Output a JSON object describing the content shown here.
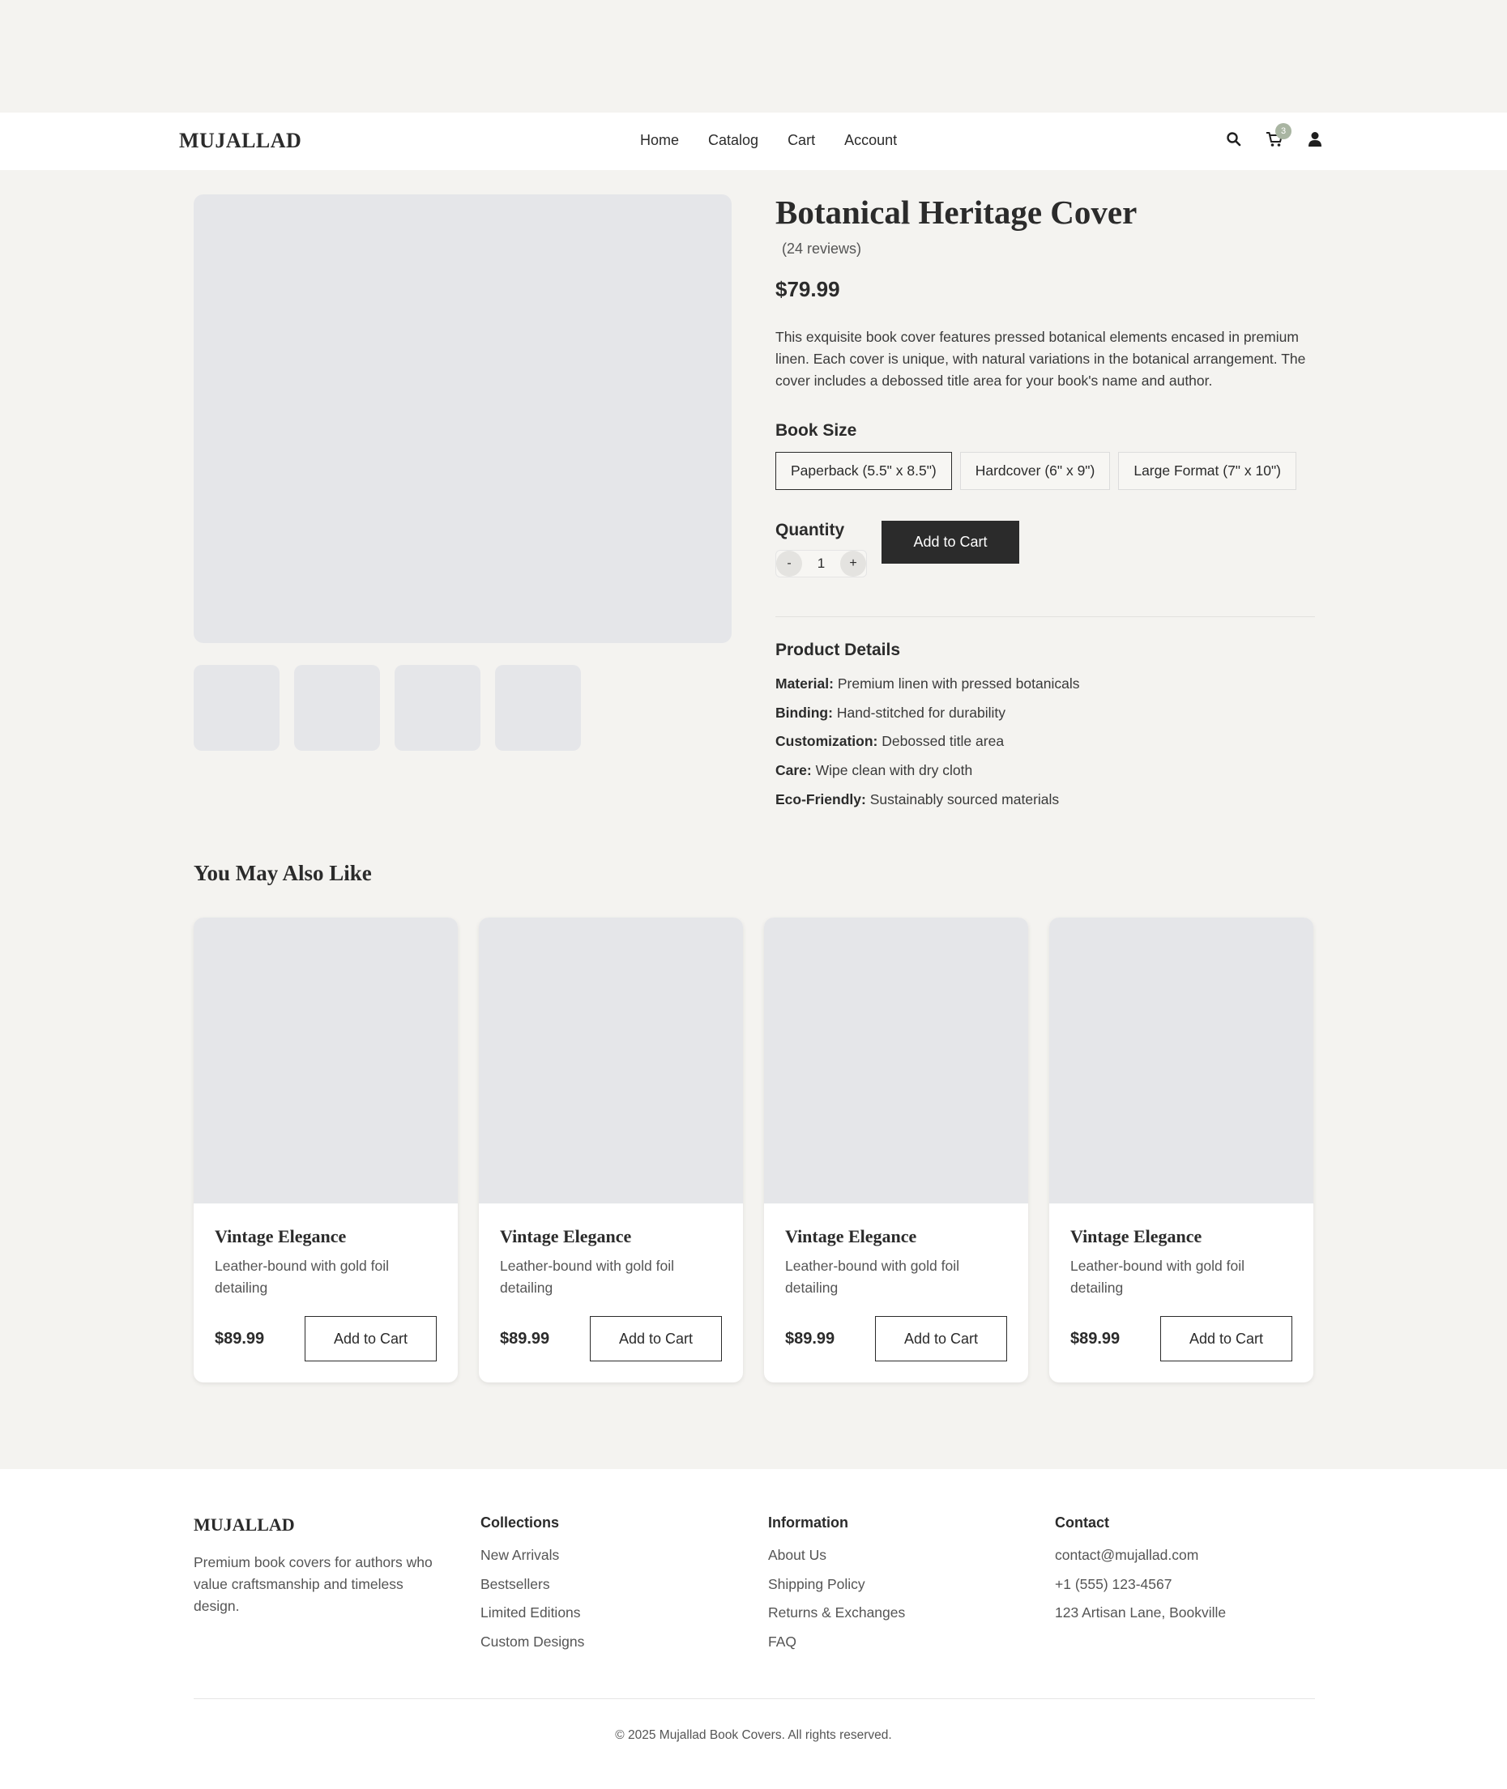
{
  "header": {
    "logo": "MUJALLAD",
    "nav": [
      "Home",
      "Catalog",
      "Cart",
      "Account"
    ],
    "cart_count": "3",
    "icons": [
      "search-icon",
      "cart-icon",
      "user-icon"
    ]
  },
  "product": {
    "title": "Botanical Heritage Cover",
    "reviews": "(24 reviews)",
    "price": "$79.99",
    "description": "This exquisite book cover features pressed botanical elements encased in premium linen. Each cover is unique, with natural variations in the botanical arrangement. The cover includes a debossed title area for your book's name and author.",
    "size_label": "Book Size",
    "sizes": [
      "Paperback (5.5\" x 8.5\")",
      "Hardcover (6\" x 9\")",
      "Large Format (7\" x 10\")"
    ],
    "selected_size": "Paperback (5.5\" x 8.5\")",
    "quantity_label": "Quantity",
    "quantity": "1",
    "minus": "-",
    "plus": "+",
    "add_to_cart": "Add to Cart",
    "details_title": "Product Details",
    "details": [
      {
        "label": "Material:",
        "value": "Premium linen with pressed botanicals"
      },
      {
        "label": "Binding:",
        "value": "Hand-stitched for durability"
      },
      {
        "label": "Customization:",
        "value": "Debossed title area"
      },
      {
        "label": "Care:",
        "value": "Wipe clean with dry cloth"
      },
      {
        "label": "Eco-Friendly:",
        "value": "Sustainably sourced materials"
      }
    ]
  },
  "related": {
    "title": "You May Also Like",
    "items": [
      {
        "name": "Vintage Elegance",
        "desc": "Leather-bound with gold foil detailing",
        "price": "$89.99",
        "button": "Add to Cart"
      },
      {
        "name": "Vintage Elegance",
        "desc": "Leather-bound with gold foil detailing",
        "price": "$89.99",
        "button": "Add to Cart"
      },
      {
        "name": "Vintage Elegance",
        "desc": "Leather-bound with gold foil detailing",
        "price": "$89.99",
        "button": "Add to Cart"
      },
      {
        "name": "Vintage Elegance",
        "desc": "Leather-bound with gold foil detailing",
        "price": "$89.99",
        "button": "Add to Cart"
      }
    ]
  },
  "footer": {
    "logo": "MUJALLAD",
    "about": "Premium book covers for authors who value craftsmanship and timeless design.",
    "collections": {
      "heading": "Collections",
      "links": [
        "New Arrivals",
        "Bestsellers",
        "Limited Editions",
        "Custom Designs"
      ]
    },
    "information": {
      "heading": "Information",
      "links": [
        "About Us",
        "Shipping Policy",
        "Returns & Exchanges",
        "FAQ"
      ]
    },
    "contact": {
      "heading": "Contact",
      "links": [
        "contact@mujallad.com",
        "+1 (555) 123-4567",
        "123 Artisan Lane, Bookville"
      ]
    },
    "copyright": "© 2025 Mujallad Book Covers. All rights reserved."
  },
  "colors": {
    "background": "#f4f3f0",
    "surface": "#ffffff",
    "placeholder": "#e5e6e9",
    "text": "#2b2b2b",
    "muted": "#555555",
    "badge": "#a9b5a2"
  }
}
